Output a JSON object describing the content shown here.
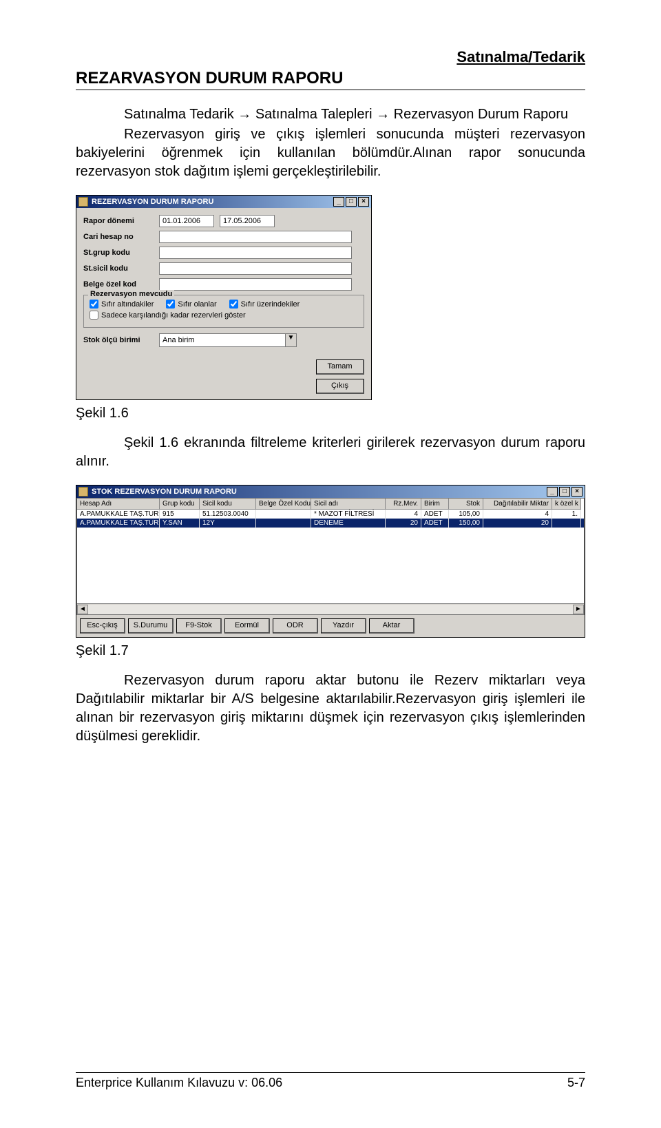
{
  "header": {
    "right": "Satınalma/Tedarik"
  },
  "title": "REZARVASYON DURUM RAPORU",
  "para1": "Satınalma Tedarik → Satınalma Talepleri → Rezervasyon Durum Raporu",
  "para2": "Rezervasyon giriş ve çıkış işlemleri sonucunda müşteri rezervasyon bakiyelerini öğrenmek için kullanılan bölümdür.Alınan rapor sonucunda rezervasyon stok dağıtım işlemi gerçekleştirilebilir.",
  "caption1": "Şekil 1.6",
  "para3": "Şekil 1.6 ekranında filtreleme kriterleri girilerek rezervasyon durum raporu alınır.",
  "caption2": "Şekil 1.7",
  "para4": "Rezervasyon durum raporu aktar butonu ile Rezerv miktarları veya Dağıtılabilir miktarlar bir A/S belgesine aktarılabilir.Rezervasyon giriş işlemleri ile alınan bir rezervasyon giriş miktarını düşmek için rezervasyon çıkış işlemlerinden düşülmesi gereklidir.",
  "footer": {
    "left": "Enterprice Kullanım Kılavuzu v: 06.06",
    "right": "5-7"
  },
  "dlg1": {
    "title": "REZERVASYON DURUM RAPORU",
    "labels": {
      "rapor_donemi": "Rapor dönemi",
      "cari_hesap_no": "Cari hesap no",
      "st_grup_kodu": "St.grup kodu",
      "st_sicil_kodu": "St.sicil kodu",
      "belge_ozel_kod": "Belge özel kod"
    },
    "values": {
      "date_from": "01.01.2006",
      "date_to": "17.05.2006"
    },
    "legend": "Rezervasyon mevcudu",
    "checks": {
      "sifir_altinda": "Sıfır altındakiler",
      "sifir_olanlar": "Sıfır olanlar",
      "sifir_uzerinde": "Sıfır üzerindekiler",
      "sadece_karsi": "Sadece karşılandığı kadar rezervleri göster"
    },
    "combo_label": "Stok ölçü birimi",
    "combo_value": "Ana birim",
    "btn_ok": "Tamam",
    "btn_exit": "Çıkış"
  },
  "dlg2": {
    "title": "STOK REZERVASYON DURUM RAPORU",
    "cols": [
      "Hesap Adı",
      "Grup kodu",
      "Sicil kodu",
      "Belge Özel Kodu",
      "Sicil adı",
      "Rz.Mev.",
      "Birim",
      "Stok",
      "Dağıtılabilir Miktar",
      "k özel k"
    ],
    "rows": [
      {
        "c0": "A.PAMUKKALE TAŞ.TUR.",
        "c1": "915",
        "c2": "51.12503.0040",
        "c3": "",
        "c4": "* MAZOT FİLTRESİ",
        "c5": "4",
        "c6": "ADET",
        "c7": "105,00",
        "c8": "4",
        "c9": "1."
      },
      {
        "c0": "A.PAMUKKALE TAŞ.TUR.",
        "c1": "Y.SAN",
        "c2": "12Y",
        "c3": "",
        "c4": "DENEME",
        "c5": "20",
        "c6": "ADET",
        "c7": "150,00",
        "c8": "20",
        "c9": ""
      }
    ],
    "buttons": [
      "Esc-çıkış",
      "S.Durumu",
      "F9-Stok",
      "Eormül",
      "ODR",
      "Yazdır",
      "Aktar"
    ],
    "scroll_up": "▲"
  }
}
